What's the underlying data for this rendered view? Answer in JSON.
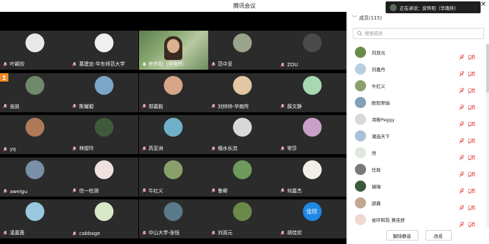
{
  "window": {
    "title": "腾讯会议",
    "close_glyph": "✕"
  },
  "toast": {
    "text": "正在讲话：房怀阳（华南所）"
  },
  "grid": {
    "tiles": [
      {
        "name": "叶颖欣",
        "avatar": "#e8e8e8",
        "type": "avatar",
        "mic": "off"
      },
      {
        "name": "葛建忠-华东师范大学",
        "avatar": "#efefef",
        "type": "avatar",
        "mic": "off"
      },
      {
        "name": "房怀阳（华南所）",
        "type": "video",
        "mic": "on"
      },
      {
        "name": "范中亚",
        "avatar": "#9aa48a",
        "type": "avatar",
        "mic": "off"
      },
      {
        "name": "ZOU",
        "avatar": "#4a4a4a",
        "type": "avatar",
        "mic": "off"
      },
      {
        "name": "张凯",
        "avatar": "#6f8a6a",
        "type": "avatar",
        "mic": "off",
        "cohost": true
      },
      {
        "name": "陈耀聪",
        "avatar": "#7aa7c8",
        "type": "avatar",
        "mic": "off"
      },
      {
        "name": "郑嘉毅",
        "avatar": "#d7a68a",
        "type": "avatar",
        "mic": "off"
      },
      {
        "name": "刘帅帅-华南所",
        "avatar": "#e4c7a4",
        "type": "avatar",
        "mic": "off"
      },
      {
        "name": "薛文静",
        "avatar": "#a7d8b0",
        "type": "avatar",
        "mic": "off"
      },
      {
        "name": "yq",
        "avatar": "#b07a5a",
        "type": "avatar",
        "mic": "off"
      },
      {
        "name": "林煜玲",
        "avatar": "#3f5a3a",
        "type": "avatar",
        "mic": "off"
      },
      {
        "name": "高亚洲",
        "avatar": "#6fb0c8",
        "type": "avatar",
        "mic": "off"
      },
      {
        "name": "细水长流",
        "avatar": "#d8d8d8",
        "type": "avatar",
        "mic": "off"
      },
      {
        "name": "常莎",
        "avatar": "#c9a0c8",
        "type": "avatar",
        "mic": "off"
      },
      {
        "name": "aweigu",
        "avatar": "#7a8fa8",
        "type": "avatar",
        "mic": "off"
      },
      {
        "name": "信一检测",
        "avatar": "#f0e0e0",
        "type": "avatar",
        "mic": "off"
      },
      {
        "name": "牛红义",
        "avatar": "#8aa06a",
        "type": "avatar",
        "mic": "off"
      },
      {
        "name": "鲁卿",
        "avatar": "#6e9a5e",
        "type": "avatar",
        "mic": "off"
      },
      {
        "name": "何嘉杰",
        "avatar": "#f2efe8",
        "type": "avatar",
        "mic": "off"
      },
      {
        "name": "凌嘉茵",
        "avatar": "#9ac8e0",
        "type": "avatar",
        "mic": "off"
      },
      {
        "name": "cabbage",
        "avatar": "#d8e8c8",
        "type": "avatar",
        "mic": "off"
      },
      {
        "name": "中山大学-张恒",
        "avatar": "#5a7a8a",
        "type": "avatar",
        "mic": "off"
      },
      {
        "name": "刘双元",
        "avatar": "#6a8a4a",
        "type": "avatar",
        "mic": "off"
      },
      {
        "name": "胡佳欣",
        "avatar_text": "佳欣",
        "type": "text",
        "mic": "off"
      }
    ]
  },
  "panel": {
    "title": "成员(115)",
    "collapse_glyph": "﹀",
    "search_placeholder": "搜索成员",
    "members": [
      {
        "name": "刘双元",
        "avatar": "#6a8a4a"
      },
      {
        "name": "刘嘉丹",
        "avatar": "#b8cfe0"
      },
      {
        "name": "牛红义",
        "avatar": "#8aa06a"
      },
      {
        "name": "欧阳翠瑜",
        "avatar": "#7fa0b8"
      },
      {
        "name": "渴殿Peggy",
        "avatar": "#d8d8d8"
      },
      {
        "name": "潮选天下",
        "avatar": "#a8c0d8"
      },
      {
        "name": "然",
        "avatar": "#e0e8e0"
      },
      {
        "name": "任政",
        "avatar": "#7a7a7a"
      },
      {
        "name": "瑞瑞",
        "avatar": "#3a5a3a"
      },
      {
        "name": "邵晨",
        "avatar": "#c0a890"
      },
      {
        "name": "省环和院 黄佳舒",
        "avatar": "#f0d8d0"
      }
    ],
    "unmute_label": "解除静音",
    "rename_label": "改名"
  }
}
